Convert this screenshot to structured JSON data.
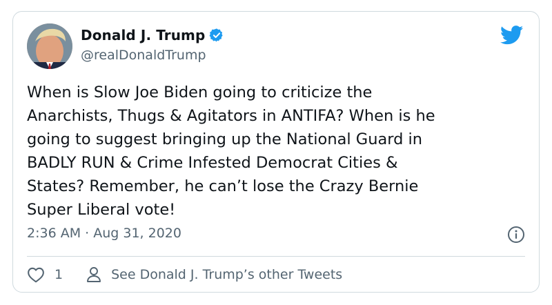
{
  "author": {
    "display_name": "Donald J. Trump",
    "handle": "@realDonaldTrump",
    "verified": true
  },
  "tweet": {
    "text": "When is Slow Joe Biden going to criticize the\nAnarchists, Thugs & Agitators in ANTIFA? When is he\ngoing to suggest bringing up the National Guard in\nBADLY RUN & Crime Infested Democrat Cities &\nStates? Remember, he can’t lose the Crazy Bernie\nSuper Liberal vote!",
    "timestamp": "2:36 AM · Aug 31, 2020"
  },
  "actions": {
    "like_count": "1",
    "profile_link_label": "See Donald J. Trump’s other Tweets"
  },
  "icons": {
    "brand": "twitter-bird-icon",
    "verified": "verified-badge-icon",
    "info": "info-icon",
    "like": "heart-icon",
    "profile": "person-icon"
  },
  "colors": {
    "twitter_blue": "#1d9bf0",
    "secondary_text": "#536471",
    "border": "#cfd9de"
  }
}
